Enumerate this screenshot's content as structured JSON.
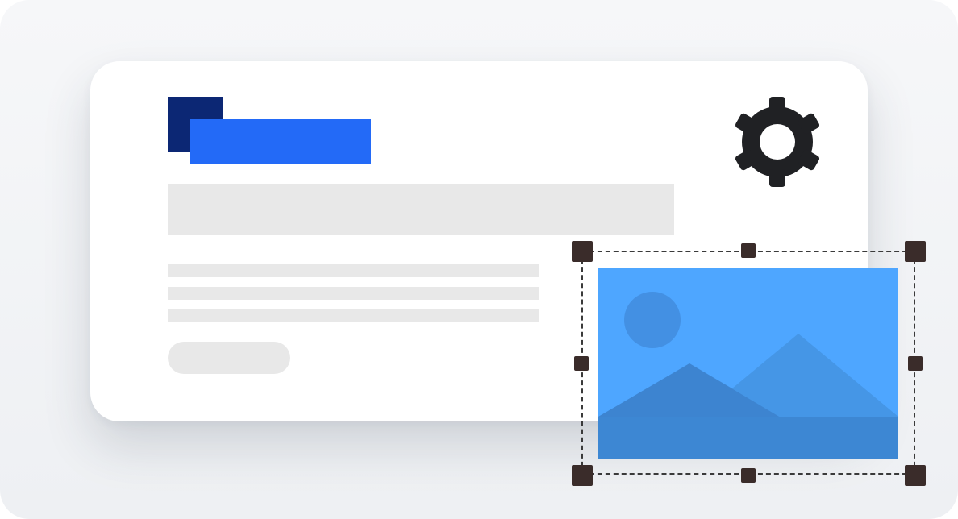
{
  "colors": {
    "logo_dark": "#0c2774",
    "logo_accent": "#236af7",
    "placeholder_gray": "#e8e8e8",
    "gear": "#202124",
    "image_sky": "#4ea6ff",
    "selection_handle": "#3a2c2a"
  },
  "icons": {
    "settings": "gear-icon",
    "image": "image-placeholder-icon"
  },
  "selection": {
    "handles": [
      "top-left",
      "top-center",
      "top-right",
      "middle-left",
      "middle-right",
      "bottom-left",
      "bottom-center",
      "bottom-right"
    ]
  }
}
